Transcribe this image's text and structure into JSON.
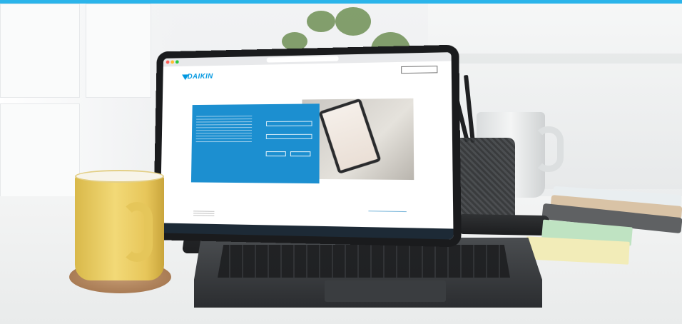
{
  "colors": {
    "accent_bar": "#2bb4ea",
    "brand_blue": "#0097e0",
    "hero_blue": "#1c8fd0",
    "mug_yellow": "#f2d977",
    "sticky_green": "#bfe3c2",
    "sticky_yellow": "#f2ecb8"
  },
  "scene": {
    "description_items": [
      "yellow-mug",
      "cork-coaster",
      "tablet-with-keyboard",
      "pen-cup",
      "white-mug",
      "notebooks",
      "sticky-notes",
      "marker",
      "plant"
    ]
  },
  "tablet_screen": {
    "brand": "DAIKIN",
    "language_select": "",
    "hero_title": "",
    "login_title": "",
    "login_button_1": "",
    "login_button_2": ""
  }
}
